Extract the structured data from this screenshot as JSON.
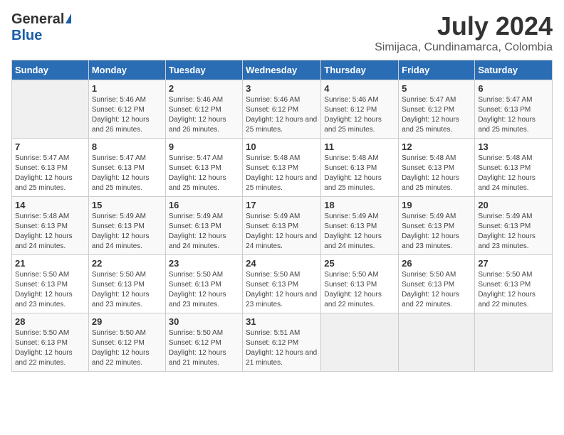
{
  "logo": {
    "general": "General",
    "blue": "Blue"
  },
  "title": "July 2024",
  "subtitle": "Simijaca, Cundinamarca, Colombia",
  "days_of_week": [
    "Sunday",
    "Monday",
    "Tuesday",
    "Wednesday",
    "Thursday",
    "Friday",
    "Saturday"
  ],
  "weeks": [
    [
      {
        "day": "",
        "sunrise": "",
        "sunset": "",
        "daylight": "",
        "empty": true
      },
      {
        "day": "1",
        "sunrise": "Sunrise: 5:46 AM",
        "sunset": "Sunset: 6:12 PM",
        "daylight": "Daylight: 12 hours and 26 minutes."
      },
      {
        "day": "2",
        "sunrise": "Sunrise: 5:46 AM",
        "sunset": "Sunset: 6:12 PM",
        "daylight": "Daylight: 12 hours and 26 minutes."
      },
      {
        "day": "3",
        "sunrise": "Sunrise: 5:46 AM",
        "sunset": "Sunset: 6:12 PM",
        "daylight": "Daylight: 12 hours and 25 minutes."
      },
      {
        "day": "4",
        "sunrise": "Sunrise: 5:46 AM",
        "sunset": "Sunset: 6:12 PM",
        "daylight": "Daylight: 12 hours and 25 minutes."
      },
      {
        "day": "5",
        "sunrise": "Sunrise: 5:47 AM",
        "sunset": "Sunset: 6:12 PM",
        "daylight": "Daylight: 12 hours and 25 minutes."
      },
      {
        "day": "6",
        "sunrise": "Sunrise: 5:47 AM",
        "sunset": "Sunset: 6:13 PM",
        "daylight": "Daylight: 12 hours and 25 minutes."
      }
    ],
    [
      {
        "day": "7",
        "sunrise": "Sunrise: 5:47 AM",
        "sunset": "Sunset: 6:13 PM",
        "daylight": "Daylight: 12 hours and 25 minutes."
      },
      {
        "day": "8",
        "sunrise": "Sunrise: 5:47 AM",
        "sunset": "Sunset: 6:13 PM",
        "daylight": "Daylight: 12 hours and 25 minutes."
      },
      {
        "day": "9",
        "sunrise": "Sunrise: 5:47 AM",
        "sunset": "Sunset: 6:13 PM",
        "daylight": "Daylight: 12 hours and 25 minutes."
      },
      {
        "day": "10",
        "sunrise": "Sunrise: 5:48 AM",
        "sunset": "Sunset: 6:13 PM",
        "daylight": "Daylight: 12 hours and 25 minutes."
      },
      {
        "day": "11",
        "sunrise": "Sunrise: 5:48 AM",
        "sunset": "Sunset: 6:13 PM",
        "daylight": "Daylight: 12 hours and 25 minutes."
      },
      {
        "day": "12",
        "sunrise": "Sunrise: 5:48 AM",
        "sunset": "Sunset: 6:13 PM",
        "daylight": "Daylight: 12 hours and 25 minutes."
      },
      {
        "day": "13",
        "sunrise": "Sunrise: 5:48 AM",
        "sunset": "Sunset: 6:13 PM",
        "daylight": "Daylight: 12 hours and 24 minutes."
      }
    ],
    [
      {
        "day": "14",
        "sunrise": "Sunrise: 5:48 AM",
        "sunset": "Sunset: 6:13 PM",
        "daylight": "Daylight: 12 hours and 24 minutes."
      },
      {
        "day": "15",
        "sunrise": "Sunrise: 5:49 AM",
        "sunset": "Sunset: 6:13 PM",
        "daylight": "Daylight: 12 hours and 24 minutes."
      },
      {
        "day": "16",
        "sunrise": "Sunrise: 5:49 AM",
        "sunset": "Sunset: 6:13 PM",
        "daylight": "Daylight: 12 hours and 24 minutes."
      },
      {
        "day": "17",
        "sunrise": "Sunrise: 5:49 AM",
        "sunset": "Sunset: 6:13 PM",
        "daylight": "Daylight: 12 hours and 24 minutes."
      },
      {
        "day": "18",
        "sunrise": "Sunrise: 5:49 AM",
        "sunset": "Sunset: 6:13 PM",
        "daylight": "Daylight: 12 hours and 24 minutes."
      },
      {
        "day": "19",
        "sunrise": "Sunrise: 5:49 AM",
        "sunset": "Sunset: 6:13 PM",
        "daylight": "Daylight: 12 hours and 23 minutes."
      },
      {
        "day": "20",
        "sunrise": "Sunrise: 5:49 AM",
        "sunset": "Sunset: 6:13 PM",
        "daylight": "Daylight: 12 hours and 23 minutes."
      }
    ],
    [
      {
        "day": "21",
        "sunrise": "Sunrise: 5:50 AM",
        "sunset": "Sunset: 6:13 PM",
        "daylight": "Daylight: 12 hours and 23 minutes."
      },
      {
        "day": "22",
        "sunrise": "Sunrise: 5:50 AM",
        "sunset": "Sunset: 6:13 PM",
        "daylight": "Daylight: 12 hours and 23 minutes."
      },
      {
        "day": "23",
        "sunrise": "Sunrise: 5:50 AM",
        "sunset": "Sunset: 6:13 PM",
        "daylight": "Daylight: 12 hours and 23 minutes."
      },
      {
        "day": "24",
        "sunrise": "Sunrise: 5:50 AM",
        "sunset": "Sunset: 6:13 PM",
        "daylight": "Daylight: 12 hours and 23 minutes."
      },
      {
        "day": "25",
        "sunrise": "Sunrise: 5:50 AM",
        "sunset": "Sunset: 6:13 PM",
        "daylight": "Daylight: 12 hours and 22 minutes."
      },
      {
        "day": "26",
        "sunrise": "Sunrise: 5:50 AM",
        "sunset": "Sunset: 6:13 PM",
        "daylight": "Daylight: 12 hours and 22 minutes."
      },
      {
        "day": "27",
        "sunrise": "Sunrise: 5:50 AM",
        "sunset": "Sunset: 6:13 PM",
        "daylight": "Daylight: 12 hours and 22 minutes."
      }
    ],
    [
      {
        "day": "28",
        "sunrise": "Sunrise: 5:50 AM",
        "sunset": "Sunset: 6:13 PM",
        "daylight": "Daylight: 12 hours and 22 minutes."
      },
      {
        "day": "29",
        "sunrise": "Sunrise: 5:50 AM",
        "sunset": "Sunset: 6:12 PM",
        "daylight": "Daylight: 12 hours and 22 minutes."
      },
      {
        "day": "30",
        "sunrise": "Sunrise: 5:50 AM",
        "sunset": "Sunset: 6:12 PM",
        "daylight": "Daylight: 12 hours and 21 minutes."
      },
      {
        "day": "31",
        "sunrise": "Sunrise: 5:51 AM",
        "sunset": "Sunset: 6:12 PM",
        "daylight": "Daylight: 12 hours and 21 minutes."
      },
      {
        "day": "",
        "sunrise": "",
        "sunset": "",
        "daylight": "",
        "empty": true
      },
      {
        "day": "",
        "sunrise": "",
        "sunset": "",
        "daylight": "",
        "empty": true
      },
      {
        "day": "",
        "sunrise": "",
        "sunset": "",
        "daylight": "",
        "empty": true
      }
    ]
  ]
}
